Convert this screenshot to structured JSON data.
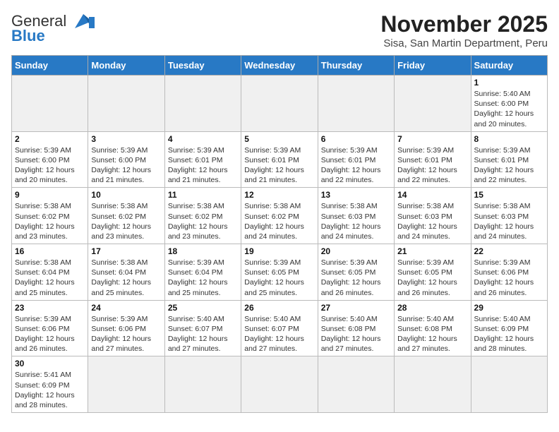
{
  "header": {
    "logo_general": "General",
    "logo_blue": "Blue",
    "month_year": "November 2025",
    "location": "Sisa, San Martin Department, Peru"
  },
  "weekdays": [
    "Sunday",
    "Monday",
    "Tuesday",
    "Wednesday",
    "Thursday",
    "Friday",
    "Saturday"
  ],
  "weeks": [
    [
      {
        "day": "",
        "info": ""
      },
      {
        "day": "",
        "info": ""
      },
      {
        "day": "",
        "info": ""
      },
      {
        "day": "",
        "info": ""
      },
      {
        "day": "",
        "info": ""
      },
      {
        "day": "",
        "info": ""
      },
      {
        "day": "1",
        "info": "Sunrise: 5:40 AM\nSunset: 6:00 PM\nDaylight: 12 hours and 20 minutes."
      }
    ],
    [
      {
        "day": "2",
        "info": "Sunrise: 5:39 AM\nSunset: 6:00 PM\nDaylight: 12 hours and 20 minutes."
      },
      {
        "day": "3",
        "info": "Sunrise: 5:39 AM\nSunset: 6:00 PM\nDaylight: 12 hours and 21 minutes."
      },
      {
        "day": "4",
        "info": "Sunrise: 5:39 AM\nSunset: 6:01 PM\nDaylight: 12 hours and 21 minutes."
      },
      {
        "day": "5",
        "info": "Sunrise: 5:39 AM\nSunset: 6:01 PM\nDaylight: 12 hours and 21 minutes."
      },
      {
        "day": "6",
        "info": "Sunrise: 5:39 AM\nSunset: 6:01 PM\nDaylight: 12 hours and 22 minutes."
      },
      {
        "day": "7",
        "info": "Sunrise: 5:39 AM\nSunset: 6:01 PM\nDaylight: 12 hours and 22 minutes."
      },
      {
        "day": "8",
        "info": "Sunrise: 5:39 AM\nSunset: 6:01 PM\nDaylight: 12 hours and 22 minutes."
      }
    ],
    [
      {
        "day": "9",
        "info": "Sunrise: 5:38 AM\nSunset: 6:02 PM\nDaylight: 12 hours and 23 minutes."
      },
      {
        "day": "10",
        "info": "Sunrise: 5:38 AM\nSunset: 6:02 PM\nDaylight: 12 hours and 23 minutes."
      },
      {
        "day": "11",
        "info": "Sunrise: 5:38 AM\nSunset: 6:02 PM\nDaylight: 12 hours and 23 minutes."
      },
      {
        "day": "12",
        "info": "Sunrise: 5:38 AM\nSunset: 6:02 PM\nDaylight: 12 hours and 24 minutes."
      },
      {
        "day": "13",
        "info": "Sunrise: 5:38 AM\nSunset: 6:03 PM\nDaylight: 12 hours and 24 minutes."
      },
      {
        "day": "14",
        "info": "Sunrise: 5:38 AM\nSunset: 6:03 PM\nDaylight: 12 hours and 24 minutes."
      },
      {
        "day": "15",
        "info": "Sunrise: 5:38 AM\nSunset: 6:03 PM\nDaylight: 12 hours and 24 minutes."
      }
    ],
    [
      {
        "day": "16",
        "info": "Sunrise: 5:38 AM\nSunset: 6:04 PM\nDaylight: 12 hours and 25 minutes."
      },
      {
        "day": "17",
        "info": "Sunrise: 5:38 AM\nSunset: 6:04 PM\nDaylight: 12 hours and 25 minutes."
      },
      {
        "day": "18",
        "info": "Sunrise: 5:39 AM\nSunset: 6:04 PM\nDaylight: 12 hours and 25 minutes."
      },
      {
        "day": "19",
        "info": "Sunrise: 5:39 AM\nSunset: 6:05 PM\nDaylight: 12 hours and 25 minutes."
      },
      {
        "day": "20",
        "info": "Sunrise: 5:39 AM\nSunset: 6:05 PM\nDaylight: 12 hours and 26 minutes."
      },
      {
        "day": "21",
        "info": "Sunrise: 5:39 AM\nSunset: 6:05 PM\nDaylight: 12 hours and 26 minutes."
      },
      {
        "day": "22",
        "info": "Sunrise: 5:39 AM\nSunset: 6:06 PM\nDaylight: 12 hours and 26 minutes."
      }
    ],
    [
      {
        "day": "23",
        "info": "Sunrise: 5:39 AM\nSunset: 6:06 PM\nDaylight: 12 hours and 26 minutes."
      },
      {
        "day": "24",
        "info": "Sunrise: 5:39 AM\nSunset: 6:06 PM\nDaylight: 12 hours and 27 minutes."
      },
      {
        "day": "25",
        "info": "Sunrise: 5:40 AM\nSunset: 6:07 PM\nDaylight: 12 hours and 27 minutes."
      },
      {
        "day": "26",
        "info": "Sunrise: 5:40 AM\nSunset: 6:07 PM\nDaylight: 12 hours and 27 minutes."
      },
      {
        "day": "27",
        "info": "Sunrise: 5:40 AM\nSunset: 6:08 PM\nDaylight: 12 hours and 27 minutes."
      },
      {
        "day": "28",
        "info": "Sunrise: 5:40 AM\nSunset: 6:08 PM\nDaylight: 12 hours and 27 minutes."
      },
      {
        "day": "29",
        "info": "Sunrise: 5:40 AM\nSunset: 6:09 PM\nDaylight: 12 hours and 28 minutes."
      }
    ],
    [
      {
        "day": "30",
        "info": "Sunrise: 5:41 AM\nSunset: 6:09 PM\nDaylight: 12 hours and 28 minutes."
      },
      {
        "day": "",
        "info": ""
      },
      {
        "day": "",
        "info": ""
      },
      {
        "day": "",
        "info": ""
      },
      {
        "day": "",
        "info": ""
      },
      {
        "day": "",
        "info": ""
      },
      {
        "day": "",
        "info": ""
      }
    ]
  ]
}
